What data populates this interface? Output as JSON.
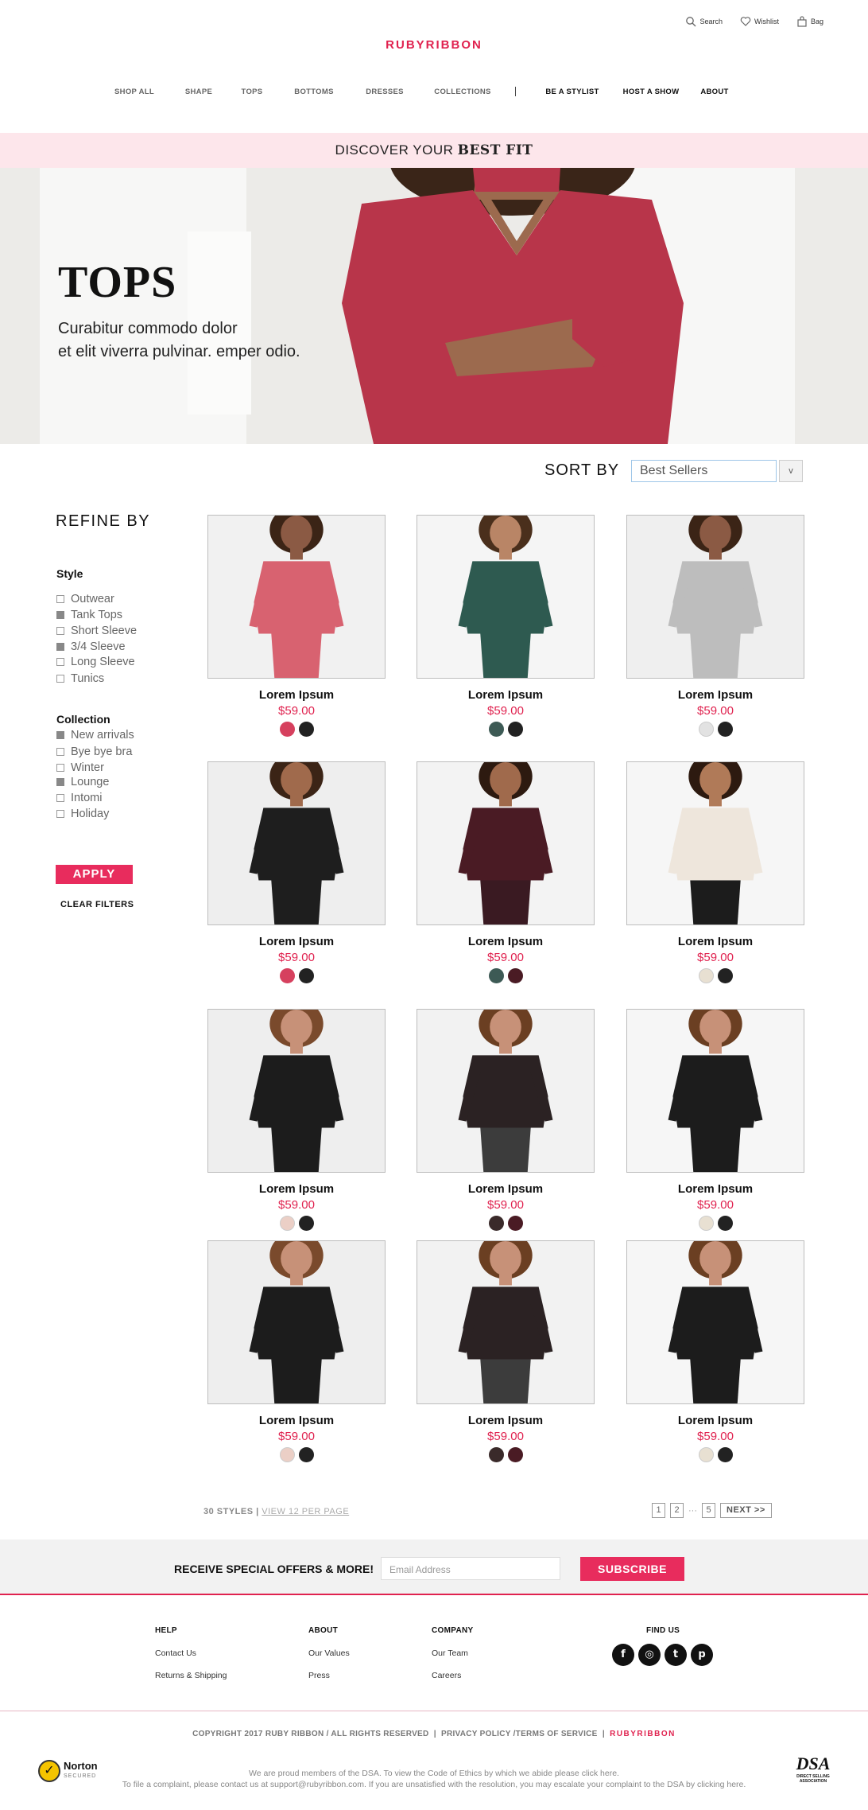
{
  "header": {
    "logo": "RUBYRIBBON",
    "utility": [
      {
        "label": "Search",
        "icon": "search-icon"
      },
      {
        "label": "Wishlist",
        "icon": "heart-icon"
      },
      {
        "label": "Bag",
        "icon": "bag-icon"
      }
    ],
    "nav": [
      {
        "label": "SHOP ALL",
        "dark": false
      },
      {
        "label": "SHAPE",
        "dark": false
      },
      {
        "label": "TOPS",
        "dark": false
      },
      {
        "label": "BOTTOMS",
        "dark": false
      },
      {
        "label": "DRESSES",
        "dark": false
      },
      {
        "label": "COLLECTIONS",
        "dark": false
      },
      {
        "label": "BE A STYLIST",
        "dark": true
      },
      {
        "label": "HOST A SHOW",
        "dark": true
      },
      {
        "label": "ABOUT",
        "dark": true
      }
    ]
  },
  "promo": {
    "prefix": "DISCOVER YOUR ",
    "emphasis": "BEST FIT"
  },
  "hero": {
    "title": "TOPS",
    "subtitle_line1": "Curabitur commodo dolor",
    "subtitle_line2": "et elit viverra pulvinar. emper odio.",
    "colors": {
      "top": "#b8354a",
      "skin": "#9c6a4e",
      "hair": "#3a2518"
    }
  },
  "sort": {
    "label": "SORT BY",
    "selected": "Best Sellers",
    "button": "v"
  },
  "refine": {
    "title": "REFINE BY",
    "groups": [
      {
        "title": "Style",
        "options": [
          {
            "label": "Outwear",
            "checked": false
          },
          {
            "label": "Tank Tops",
            "checked": true
          },
          {
            "label": "Short Sleeve",
            "checked": false
          },
          {
            "label": "3/4 Sleeve",
            "checked": true
          },
          {
            "label": "Long Sleeve",
            "checked": false
          },
          {
            "label": "Tunics",
            "checked": false
          }
        ]
      },
      {
        "title": "Collection",
        "options": [
          {
            "label": "New arrivals",
            "checked": true
          },
          {
            "label": "Bye bye bra",
            "checked": false
          },
          {
            "label": "Winter",
            "checked": false
          },
          {
            "label": "Lounge",
            "checked": true
          },
          {
            "label": "Intomi",
            "checked": false
          },
          {
            "label": "Holiday",
            "checked": false
          }
        ]
      }
    ],
    "apply": "APPLY",
    "clear": "CLEAR FILTERS"
  },
  "products": [
    {
      "name": "Lorem Ipsum",
      "price": "$59.00",
      "garment": "#d86270",
      "bottom": "#d86270",
      "skin": "#8b5a44",
      "hair": "#3b2416",
      "bg": "#f1f1f1",
      "swatches": [
        "#d6405e",
        "#222222"
      ]
    },
    {
      "name": "Lorem Ipsum",
      "price": "$59.00",
      "garment": "#2e5a50",
      "bottom": "#2e5a50",
      "skin": "#b98566",
      "hair": "#4a2f1c",
      "bg": "#f5f5f5",
      "swatches": [
        "#3d5a55",
        "#222222"
      ]
    },
    {
      "name": "Lorem Ipsum",
      "price": "$59.00",
      "garment": "#bdbdbd",
      "bottom": "#bdbdbd",
      "skin": "#8b5a44",
      "hair": "#3b2416",
      "bg": "#efefef",
      "swatches": [
        "#e2e2e2",
        "#222222"
      ]
    },
    {
      "name": "Lorem Ipsum",
      "price": "$59.00",
      "garment": "#1e1e1e",
      "bottom": "#1e1e1e",
      "skin": "#a06a4c",
      "hair": "#3b2416",
      "bg": "#eeeeee",
      "swatches": [
        "#d6405e",
        "#222222"
      ]
    },
    {
      "name": "Lorem Ipsum",
      "price": "$59.00",
      "garment": "#4a1b24",
      "bottom": "#3a1a22",
      "skin": "#a06a4c",
      "hair": "#2d1a10",
      "bg": "#f3f3f3",
      "swatches": [
        "#3d5a55",
        "#4a1b24"
      ]
    },
    {
      "name": "Lorem Ipsum",
      "price": "$59.00",
      "garment": "#eee6dc",
      "bottom": "#1c1c1c",
      "skin": "#b07a58",
      "hair": "#2d1a10",
      "bg": "#f6f6f6",
      "swatches": [
        "#e8e0d2",
        "#222222"
      ]
    },
    {
      "name": "Lorem Ipsum",
      "price": "$59.00",
      "garment": "#1c1c1c",
      "bottom": "#1c1c1c",
      "skin": "#c79178",
      "hair": "#7a4a2c",
      "bg": "#eeeeee",
      "swatches": [
        "#ebcfc6",
        "#222222"
      ]
    },
    {
      "name": "Lorem Ipsum",
      "price": "$59.00",
      "garment": "#2b2223",
      "bottom": "#3c3c3c",
      "skin": "#c79178",
      "hair": "#6b3f22",
      "bg": "#f2f2f2",
      "swatches": [
        "#3a2a2a",
        "#4a1b24"
      ]
    },
    {
      "name": "Lorem Ipsum",
      "price": "$59.00",
      "garment": "#1c1c1c",
      "bottom": "#1c1c1c",
      "skin": "#c79178",
      "hair": "#6b3f22",
      "bg": "#f6f6f6",
      "swatches": [
        "#e8e0d2",
        "#222222"
      ]
    },
    {
      "name": "Lorem Ipsum",
      "price": "$59.00",
      "garment": "#1c1c1c",
      "bottom": "#1c1c1c",
      "skin": "#c79178",
      "hair": "#7a4a2c",
      "bg": "#eeeeee",
      "swatches": [
        "#ebcfc6",
        "#222222"
      ]
    },
    {
      "name": "Lorem Ipsum",
      "price": "$59.00",
      "garment": "#2b2223",
      "bottom": "#3c3c3c",
      "skin": "#c79178",
      "hair": "#6b3f22",
      "bg": "#f2f2f2",
      "swatches": [
        "#3a2a2a",
        "#4a1b24"
      ]
    },
    {
      "name": "Lorem Ipsum",
      "price": "$59.00",
      "garment": "#1c1c1c",
      "bottom": "#1c1c1c",
      "skin": "#c79178",
      "hair": "#6b3f22",
      "bg": "#f6f6f6",
      "swatches": [
        "#e8e0d2",
        "#222222"
      ]
    }
  ],
  "results": {
    "count": "30 STYLES",
    "separator": " | ",
    "view": "VIEW 12 PER PAGE"
  },
  "pagination": {
    "pages": [
      "1",
      "2"
    ],
    "dots": "···",
    "last": "5",
    "next": "NEXT >>"
  },
  "newsletter": {
    "title": "RECEIVE SPECIAL OFFERS & MORE!",
    "placeholder": "Email Address",
    "button": "SUBSCRIBE"
  },
  "footer": {
    "columns": [
      {
        "title": "HELP",
        "links": [
          "Contact Us",
          "Returns & Shipping"
        ]
      },
      {
        "title": "ABOUT",
        "links": [
          "Our Values",
          "Press"
        ]
      },
      {
        "title": "COMPANY",
        "links": [
          "Our Team",
          "Careers"
        ]
      },
      {
        "title": "FIND US",
        "links": []
      }
    ],
    "social": [
      {
        "icon": "facebook-icon",
        "glyph": "f"
      },
      {
        "icon": "instagram-icon",
        "glyph": "◎"
      },
      {
        "icon": "twitter-icon",
        "glyph": "t"
      },
      {
        "icon": "pinterest-icon",
        "glyph": "p"
      }
    ],
    "copyright": "COPYRIGHT 2017 RUBY RIBBON / ALL RIGHTS RESERVED",
    "policy": "PRIVACY POLICY /TERMS OF SERVICE",
    "brand": "RUBYRIBBON",
    "dsa_line1": "We are proud members of the DSA. To view the Code of Ethics by which we abide please click here.",
    "dsa_line2": "To file a complaint, please contact us at support@rubyribbon.com. If you are unsatisfied with the resolution, you may escalate your complaint to the DSA by clicking here.",
    "norton_name": "Norton",
    "norton_sub": "SECURED",
    "dsa_logo": "DSA",
    "dsa_caption": "DIRECT SELLING ASSOCIATION"
  }
}
